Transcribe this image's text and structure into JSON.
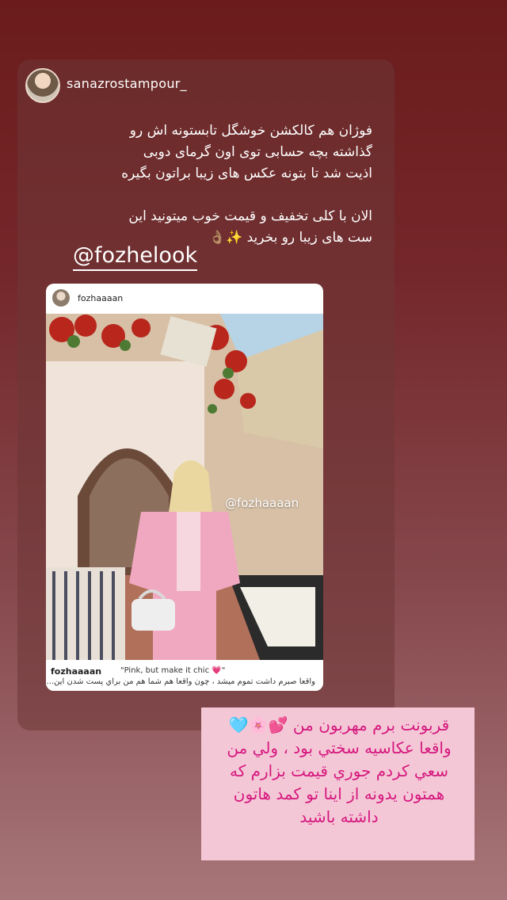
{
  "story": {
    "username": "sanazrostampour_",
    "caption_lines": [
      "فوژان هم کالکشن خوشگل تابستونه اش رو",
      "گذاشته بچه حسابی توی اون گرمای دوبی",
      "اذیت شد تا بتونه عکس های زیبا براتون بگیره",
      "",
      "الان با کلی تخفیف و قیمت خوب میتونید این",
      "ست های زیبا رو بخرید ✨👌🏽"
    ],
    "mention": "@fozhelook"
  },
  "post": {
    "username": "fozhaaaan",
    "photo_tag": "@fozhaaaan",
    "footer_user": "fozhaaaan",
    "footer_caption": "\"Pink, but make it chic 💗\"",
    "footer_caption2": "واقعا صبرم داشت تموم میشد ، چون واقعا هم شما هم من براي پست شدن اين..."
  },
  "pink_note": {
    "lines": [
      "قربونت برم مهربون من 💕🌸🩵",
      "واقعا عكاسيه سختي بود ، ولي من",
      "سعي كردم جوري قيمت بزارم كه",
      "همتون يدونه از اينا تو كمد هاتون",
      "داشته باشيد"
    ]
  }
}
